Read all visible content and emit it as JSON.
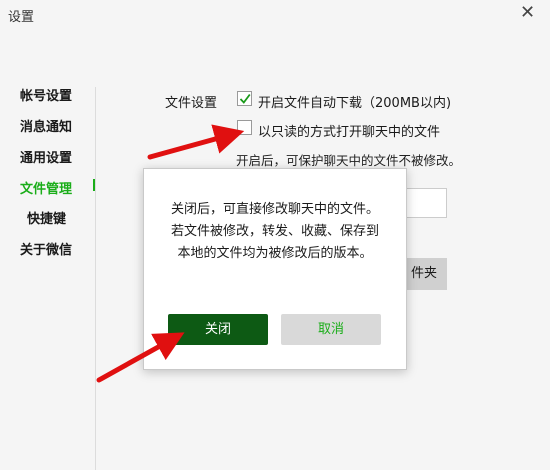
{
  "window": {
    "title": "设置",
    "close_label": "✕"
  },
  "sidebar": {
    "items": [
      {
        "label": "帐号设置",
        "active": false
      },
      {
        "label": "消息通知",
        "active": false
      },
      {
        "label": "通用设置",
        "active": false
      },
      {
        "label": "文件管理",
        "active": true
      },
      {
        "label": "快捷键",
        "active": false
      },
      {
        "label": "关于微信",
        "active": false
      }
    ]
  },
  "file_settings": {
    "section_label": "文件设置",
    "auto_download": {
      "label": "开启文件自动下载（200MB以内)",
      "checked": true
    },
    "read_only": {
      "label": "以只读的方式打开聊天中的文件",
      "checked": false
    },
    "read_only_hint": "开启后，可保护聊天中的文件不被修改。",
    "open_folder_partial": "件夹"
  },
  "dialog": {
    "message": "关闭后，可直接修改聊天中的文件。若文件被修改，转发、收藏、保存到本地的文件均为被修改后的版本。",
    "confirm_label": "关闭",
    "cancel_label": "取消"
  },
  "colors": {
    "accent": "#1aad19",
    "confirm_bg": "#0d5a14",
    "arrow": "#e01010"
  }
}
